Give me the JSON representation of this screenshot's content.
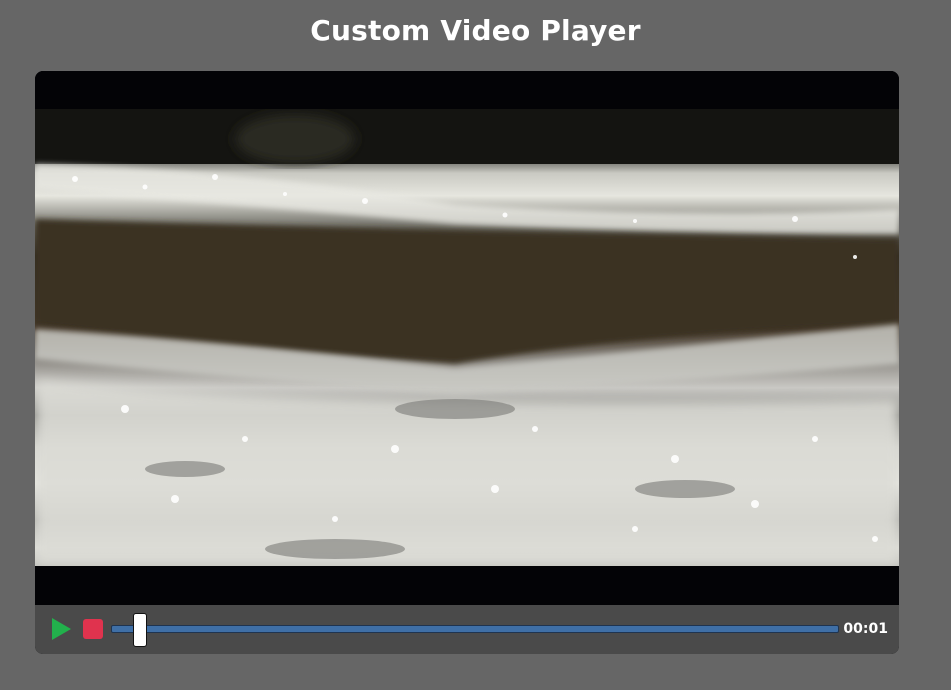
{
  "page": {
    "title": "Custom Video Player"
  },
  "player": {
    "video_icon": "flowing-water-video-frame",
    "controls": {
      "play_icon": "play-icon",
      "stop_icon": "stop-icon",
      "play_color": "#22b14c",
      "stop_color": "#e0334e",
      "progress_fraction": 0.04,
      "time": "00:01"
    }
  }
}
